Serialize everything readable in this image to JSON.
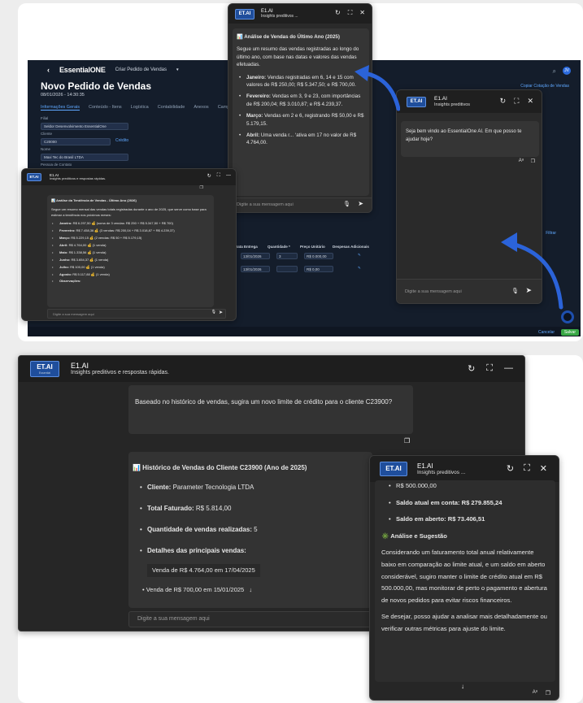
{
  "erp": {
    "brand": "EssentialONE",
    "brand_sub": "",
    "menu": "Criar Pedido de Vendas",
    "title": "Novo Pedido de Vendas",
    "date": "08/01/2026 - 14:30:35",
    "tabs": [
      "Informações Gerais",
      "Conteúdo - Itens",
      "Logística",
      "Contabilidade",
      "Anexos",
      "Campos P"
    ],
    "link_right": "Copiar Cotação de Vendas",
    "avatar": "JV",
    "fields": [
      {
        "label": "Filial",
        "value": "Seldor Desenvolvimento EssentialOne"
      },
      {
        "label": "Cliente",
        "value": "C20000"
      },
      {
        "label": "Nome",
        "value": "Maxi Tec do Brasil LTDA"
      },
      {
        "label": "Pessoa de Contato",
        "value": ""
      }
    ],
    "credit_link": "Crédito",
    "table_headers": [
      "Data Entrega",
      "Quantidade *",
      "Preço Unitário",
      "Despesas Adicionais"
    ],
    "rows": [
      [
        "13/01/2026",
        "3",
        "R$ 0.000,00",
        ""
      ],
      [
        "13/01/2026",
        "",
        "R$ 0,00",
        ""
      ]
    ],
    "filter": "Filtrar",
    "cancel": "Cancelar",
    "save": "Salvar"
  },
  "top_chat": {
    "logo": "ET.AI",
    "title": "E1.AI",
    "subtitle": "Insights preditivos ...",
    "heading": "📊 Análise de Vendas do Último Ano (2025)",
    "intro": "Segue um resumo das vendas registradas ao longo do último ano, com base nas datas e valores das vendas efetuadas.",
    "items": [
      {
        "k": "Janeiro:",
        "v": " Vendas registradas em 6, 14 e 15 com valores de R$ 250,00; R$ 5.347,50; e R$ 700,00."
      },
      {
        "k": "Fevereiro:",
        "v": " Vendas em 3, 9 e 23, com importâncias de R$ 200,04; R$ 3.010,87; e R$ 4.239,37."
      },
      {
        "k": "Março:",
        "v": " Vendas em 2 e 6, registrando R$ 50,00 e R$ 5.179,15."
      },
      {
        "k": "Abril:",
        "v": " Uma venda r... ‘ativa em 17 no valor de R$ 4.764,00."
      }
    ],
    "input": "Digite a sua mensagem aqui"
  },
  "welcome_chat": {
    "logo": "ET.AI",
    "title": "E1.AI",
    "subtitle": "Insights preditivos",
    "message": "Seja bem vindo ao EssentialOne AI. Em que posso te ajudar hoje?",
    "input": "Digite a sua mensagem aqui"
  },
  "trend_chat": {
    "logo": "ET.AI",
    "title": "E1.AI",
    "subtitle": "Insights preditivos e respostas rápidas.",
    "heading": "📊 Análise da Tendência de Vendas - Último Ano (2026)",
    "intro": "Segue um resumo mensal das vendas totais registradas durante o ano de 2025, que serve como base para estimar a tendência nos próximos meses:",
    "items": [
      {
        "k": "Janeiro:",
        "v": " R$ 6.297,50 💰 (soma de 3 vendas: R$ 250 + R$ 5.347,50 + R$ 700)"
      },
      {
        "k": "Fevereiro:",
        "v": " R$ 7.458,36 💰 (3 vendas: R$ 200,04 + R$ 3.018,87 + R$ 4.239,37)"
      },
      {
        "k": "Março:",
        "v": " R$ 5.229,15 💰 (2 vendas: R$ 50 + R$ 5.179,15)"
      },
      {
        "k": "Abril:",
        "v": " R$ 4.764,00 💰 (1 venda)"
      },
      {
        "k": "Maio:",
        "v": " R$ 1.338,56 💰 (1 venda)"
      },
      {
        "k": "Junho:",
        "v": " R$ 3.654,37 💰 (1 venda)"
      },
      {
        "k": "Julho:",
        "v": " R$ 100,00 💰 (1 venda)"
      },
      {
        "k": "Agosto:",
        "v": " R$ 5.117,88 💰 (1 venda)"
      },
      {
        "k": "Observações:",
        "v": ""
      }
    ],
    "input": "Digite a sua mensagem aqui"
  },
  "big_chat": {
    "logo": "ET.AI",
    "logo_sub": "Essential",
    "title": "E1.AI",
    "subtitle": "Insights preditivos e respostas rápidas.",
    "user_msg": "Baseado no histórico de vendas, sugira um novo limite de crédito para o cliente C23900?",
    "heading": "📊 Histórico de Vendas do Cliente C23900 (Ano de 2025)",
    "items": [
      {
        "k": "Cliente:",
        "v": " Parameter Tecnologia LTDA"
      },
      {
        "k": "Total Faturado:",
        "v": " R$ 5.814,00"
      },
      {
        "k": "Quantidade de vendas realizadas:",
        "v": " 5"
      },
      {
        "k": "Detalhes das principais vendas:",
        "v": ""
      }
    ],
    "sub1": "Venda de R$ 4.764,00 em 17/04/2025",
    "sub2": "• Venda de R$ 700,00 em 15/01/2025",
    "input": "Digite a sua mensagem aqui"
  },
  "small_chat": {
    "logo": "ET.AI",
    "title": "E1.AI",
    "subtitle": "Insights preditivos ...",
    "line0": "R$ 500.000,00",
    "items": [
      {
        "k": "Saldo atual em conta:",
        "v": " R$ 279.855,24"
      },
      {
        "k": "Saldo em aberto:",
        "v": " R$ 73.406,51"
      }
    ],
    "heading": "✳️ Análise e Sugestão",
    "p1": "Considerando um faturamento total anual relativamente baixo em comparação ao limite atual, e um saldo em aberto considerável, sugiro manter o limite de crédito atual em R$ 500.000,00, mas monitorar de perto o pagamento e abertura de novos pedidos para evitar riscos financeiros.",
    "p2": "Se desejar, posso ajudar a analisar mais detalhadamente ou verificar outras métricas para ajuste do limite."
  },
  "colors": {
    "accent": "#2f63d6",
    "arrow": "#2b63d9",
    "chat_bg": "#2a2a2a",
    "erp_bg": "#141d2b"
  }
}
